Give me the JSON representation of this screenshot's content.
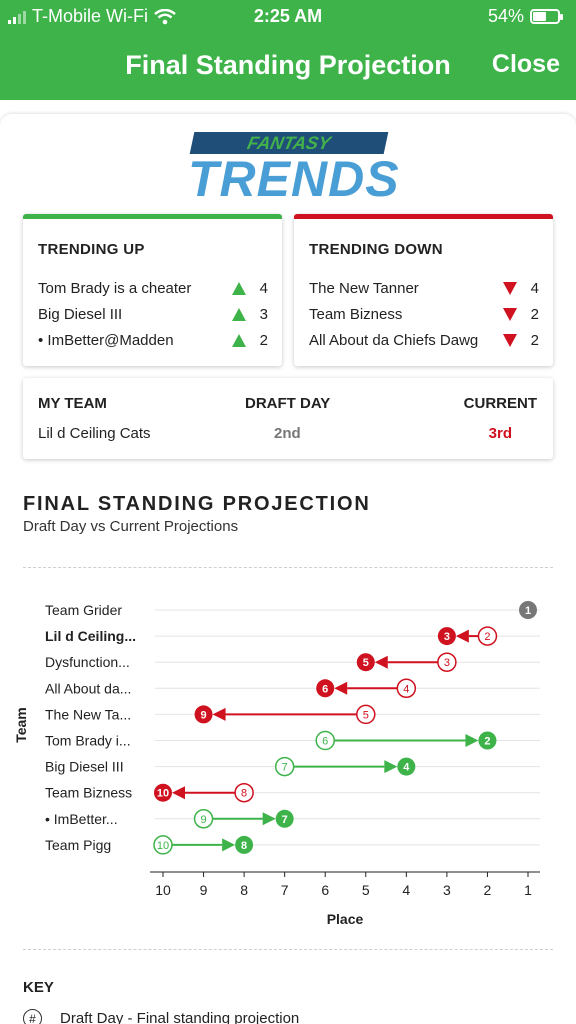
{
  "status_bar": {
    "carrier": "T-Mobile Wi-Fi",
    "time": "2:25 AM",
    "battery": "54%",
    "battery_level": 0.54
  },
  "header": {
    "title": "Final Standing Projection",
    "close_label": "Close"
  },
  "logo": {
    "top_text": "FANTASY",
    "bottom_text": "TRENDS"
  },
  "trending_up": {
    "title": "TRENDING UP",
    "items": [
      {
        "name": "Tom Brady is a cheater",
        "value": "4"
      },
      {
        "name": "Big Diesel III",
        "value": "3"
      },
      {
        "name": "• ImBetter@Madden",
        "value": "2"
      }
    ]
  },
  "trending_down": {
    "title": "TRENDING DOWN",
    "items": [
      {
        "name": "The New Tanner",
        "value": "4"
      },
      {
        "name": "Team Bizness",
        "value": "2"
      },
      {
        "name": "All About da Chiefs Dawg",
        "value": "2"
      }
    ]
  },
  "my_team": {
    "labels": {
      "team": "MY TEAM",
      "draft_day": "DRAFT DAY",
      "current": "CURRENT"
    },
    "team_name": "Lil d Ceiling Cats",
    "draft_day": "2nd",
    "current": "3rd"
  },
  "section": {
    "title": "FINAL STANDING PROJECTION",
    "subtitle": "Draft Day vs Current Projections"
  },
  "colors": {
    "green": "#3db34a",
    "red": "#d0111f",
    "gray": "#777777",
    "blue_dark": "#1f4e79",
    "blue_light": "#4a9ed6"
  },
  "chart_data": {
    "type": "dumbbell",
    "xlabel": "Place",
    "ylabel": "Team",
    "xlim": [
      10,
      1
    ],
    "x_ticks": [
      "10",
      "9",
      "8",
      "7",
      "6",
      "5",
      "4",
      "3",
      "2",
      "1"
    ],
    "rows": [
      {
        "team": "Team Grider",
        "draft_day": 1,
        "current": 1,
        "highlight": false
      },
      {
        "team": "Lil d Ceiling...",
        "draft_day": 2,
        "current": 3,
        "highlight": true
      },
      {
        "team": "Dysfunction...",
        "draft_day": 3,
        "current": 5,
        "highlight": false
      },
      {
        "team": "All About da...",
        "draft_day": 4,
        "current": 6,
        "highlight": false
      },
      {
        "team": "The New Ta...",
        "draft_day": 5,
        "current": 9,
        "highlight": false
      },
      {
        "team": "Tom Brady i...",
        "draft_day": 6,
        "current": 2,
        "highlight": false
      },
      {
        "team": "Big Diesel III",
        "draft_day": 7,
        "current": 4,
        "highlight": false
      },
      {
        "team": "Team Bizness",
        "draft_day": 8,
        "current": 10,
        "highlight": false
      },
      {
        "team": "• ImBetter...",
        "draft_day": 9,
        "current": 7,
        "highlight": false
      },
      {
        "team": "Team Pigg",
        "draft_day": 10,
        "current": 8,
        "highlight": false
      }
    ]
  },
  "key": {
    "title": "KEY",
    "items": [
      {
        "symbol": "#",
        "label": "Draft Day - Final standing projection"
      }
    ]
  }
}
